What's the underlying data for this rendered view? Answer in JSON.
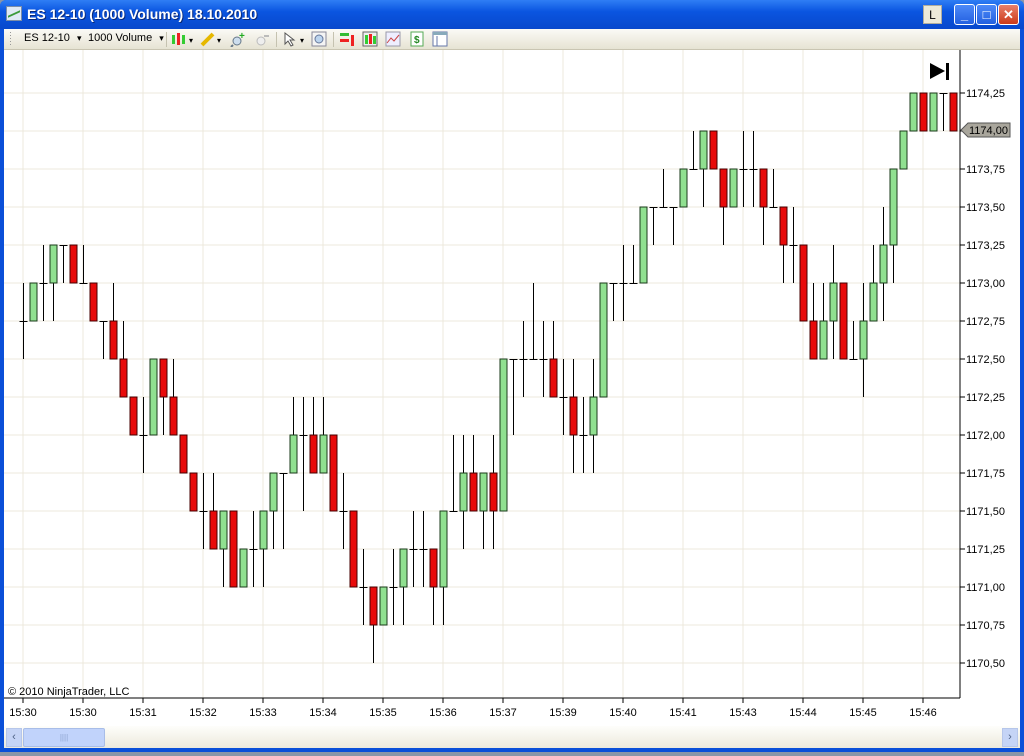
{
  "window": {
    "title": "ES 12-10 (1000 Volume)  18.10.2010",
    "l_button": "L",
    "minimize": "_",
    "maximize": "□",
    "close": "✕"
  },
  "toolbar": {
    "instrument": "ES 12-10",
    "interval": "1000 Volume",
    "dropdown": "▾",
    "icons": [
      "chart-style-icon",
      "drawing-pencil-icon",
      "zoom-in-icon",
      "zoom-out-icon",
      "cursor-icon",
      "data-box-icon",
      "strategies-icon",
      "indicators-icon",
      "chart-properties-icon",
      "dollar-icon",
      "properties-panel-icon"
    ]
  },
  "chart": {
    "copyright": "© 2010 NinjaTrader, LLC",
    "current_price_label": "1174,00",
    "scroll_to_end_icon": "skip-to-end-icon",
    "colors": {
      "up": "#90e090",
      "down": "#e80a0a",
      "grid": "#ece9dc"
    },
    "scrollbar": {
      "grip": "||||",
      "left": "‹",
      "right": "›"
    }
  },
  "chart_data": {
    "type": "candlestick",
    "title": "ES 12-10 (1000 Volume)",
    "ylim": [
      1170.5,
      1174.25
    ],
    "y_ticks": [
      "1174,25",
      "1174,00",
      "1173,75",
      "1173,50",
      "1173,25",
      "1173,00",
      "1172,75",
      "1172,50",
      "1172,25",
      "1172,00",
      "1171,75",
      "1171,50",
      "1171,25",
      "1171,00",
      "1170,75",
      "1170,50"
    ],
    "x_ticks": [
      "15:30",
      "15:30",
      "15:31",
      "15:32",
      "15:33",
      "15:34",
      "15:35",
      "15:36",
      "15:37",
      "15:39",
      "15:40",
      "15:41",
      "15:43",
      "15:44",
      "15:45",
      "15:46"
    ],
    "x_tick_every": 6,
    "ohlc": [
      [
        1172.75,
        1173,
        1172.5,
        1172.75
      ],
      [
        1172.75,
        1173,
        1172.75,
        1173
      ],
      [
        1173,
        1173.25,
        1172.75,
        1173
      ],
      [
        1173,
        1173.25,
        1172.75,
        1173.25
      ],
      [
        1173.25,
        1173.25,
        1173,
        1173.25
      ],
      [
        1173.25,
        1173.25,
        1173,
        1173
      ],
      [
        1173,
        1173.25,
        1173,
        1173
      ],
      [
        1173,
        1173,
        1172.75,
        1172.75
      ],
      [
        1172.75,
        1172.75,
        1172.5,
        1172.75
      ],
      [
        1172.75,
        1173,
        1172.5,
        1172.5
      ],
      [
        1172.5,
        1172.75,
        1172.25,
        1172.25
      ],
      [
        1172.25,
        1172.25,
        1172,
        1172
      ],
      [
        1172,
        1172.25,
        1171.75,
        1172
      ],
      [
        1172,
        1172.5,
        1172,
        1172.5
      ],
      [
        1172.5,
        1172.5,
        1172,
        1172.25
      ],
      [
        1172.25,
        1172.5,
        1172,
        1172
      ],
      [
        1172,
        1172,
        1171.75,
        1171.75
      ],
      [
        1171.75,
        1171.75,
        1171.5,
        1171.5
      ],
      [
        1171.5,
        1171.75,
        1171.25,
        1171.5
      ],
      [
        1171.5,
        1171.75,
        1171.25,
        1171.25
      ],
      [
        1171.25,
        1171.5,
        1171,
        1171.5
      ],
      [
        1171.5,
        1171.5,
        1171,
        1171
      ],
      [
        1171,
        1171.25,
        1171,
        1171.25
      ],
      [
        1171.25,
        1171.5,
        1171,
        1171.25
      ],
      [
        1171.25,
        1171.5,
        1171,
        1171.5
      ],
      [
        1171.5,
        1171.75,
        1171.25,
        1171.75
      ],
      [
        1171.75,
        1171.75,
        1171.25,
        1171.75
      ],
      [
        1171.75,
        1172.25,
        1171.75,
        1172
      ],
      [
        1172,
        1172.25,
        1171.5,
        1172
      ],
      [
        1172,
        1172.25,
        1171.75,
        1171.75
      ],
      [
        1171.75,
        1172.25,
        1171.75,
        1172
      ],
      [
        1172,
        1172,
        1171.5,
        1171.5
      ],
      [
        1171.5,
        1171.75,
        1171.25,
        1171.5
      ],
      [
        1171.5,
        1171.5,
        1171,
        1171
      ],
      [
        1171,
        1171.25,
        1170.75,
        1171
      ],
      [
        1171,
        1171,
        1170.5,
        1170.75
      ],
      [
        1170.75,
        1171,
        1170.75,
        1171
      ],
      [
        1171,
        1171.25,
        1170.75,
        1171
      ],
      [
        1171,
        1171.25,
        1170.75,
        1171.25
      ],
      [
        1171.25,
        1171.5,
        1171,
        1171.25
      ],
      [
        1171.25,
        1171.5,
        1171,
        1171.25
      ],
      [
        1171.25,
        1171.25,
        1170.75,
        1171
      ],
      [
        1171,
        1171.5,
        1170.75,
        1171.5
      ],
      [
        1171.5,
        1172,
        1171.5,
        1171.5
      ],
      [
        1171.5,
        1172,
        1171.25,
        1171.75
      ],
      [
        1171.75,
        1172,
        1171.5,
        1171.5
      ],
      [
        1171.5,
        1171.75,
        1171.25,
        1171.75
      ],
      [
        1171.75,
        1172,
        1171.25,
        1171.5
      ],
      [
        1171.5,
        1172.5,
        1171.5,
        1172.5
      ],
      [
        1172.5,
        1172.5,
        1172,
        1172.5
      ],
      [
        1172.5,
        1172.75,
        1172.25,
        1172.5
      ],
      [
        1172.5,
        1173,
        1172.5,
        1172.5
      ],
      [
        1172.5,
        1172.75,
        1172.25,
        1172.5
      ],
      [
        1172.5,
        1172.75,
        1172.25,
        1172.25
      ],
      [
        1172.25,
        1172.5,
        1172,
        1172.25
      ],
      [
        1172.25,
        1172.5,
        1171.75,
        1172
      ],
      [
        1172,
        1172.25,
        1171.75,
        1172
      ],
      [
        1172,
        1172.5,
        1171.75,
        1172.25
      ],
      [
        1172.25,
        1173,
        1172.25,
        1173
      ],
      [
        1173,
        1173,
        1172.75,
        1173
      ],
      [
        1173,
        1173.25,
        1172.75,
        1173
      ],
      [
        1173,
        1173.25,
        1173,
        1173
      ],
      [
        1173,
        1173.5,
        1173,
        1173.5
      ],
      [
        1173.5,
        1173.5,
        1173.25,
        1173.5
      ],
      [
        1173.5,
        1173.75,
        1173.5,
        1173.5
      ],
      [
        1173.5,
        1173.5,
        1173.25,
        1173.5
      ],
      [
        1173.5,
        1173.75,
        1173.5,
        1173.75
      ],
      [
        1173.75,
        1174,
        1173.75,
        1173.75
      ],
      [
        1173.75,
        1174,
        1173.5,
        1174
      ],
      [
        1174,
        1174,
        1173.75,
        1173.75
      ],
      [
        1173.75,
        1173.75,
        1173.25,
        1173.5
      ],
      [
        1173.5,
        1173.75,
        1173.5,
        1173.75
      ],
      [
        1173.75,
        1174,
        1173.5,
        1173.75
      ],
      [
        1173.75,
        1174,
        1173.5,
        1173.75
      ],
      [
        1173.75,
        1173.75,
        1173.25,
        1173.5
      ],
      [
        1173.5,
        1173.75,
        1173.5,
        1173.5
      ],
      [
        1173.5,
        1173.5,
        1173,
        1173.25
      ],
      [
        1173.25,
        1173.5,
        1173,
        1173.25
      ],
      [
        1173.25,
        1173.25,
        1172.75,
        1172.75
      ],
      [
        1172.75,
        1173,
        1172.5,
        1172.5
      ],
      [
        1172.5,
        1173,
        1172.5,
        1172.75
      ],
      [
        1172.75,
        1173.25,
        1172.5,
        1173
      ],
      [
        1173,
        1173,
        1172.5,
        1172.5
      ],
      [
        1172.5,
        1172.75,
        1172.5,
        1172.5
      ],
      [
        1172.5,
        1173,
        1172.25,
        1172.75
      ],
      [
        1172.75,
        1173.25,
        1172.75,
        1173
      ],
      [
        1173,
        1173.5,
        1172.75,
        1173.25
      ],
      [
        1173.25,
        1173.75,
        1173,
        1173.75
      ],
      [
        1173.75,
        1174,
        1173.75,
        1174
      ],
      [
        1174,
        1174.25,
        1174,
        1174.25
      ],
      [
        1174.25,
        1174.25,
        1174,
        1174
      ],
      [
        1174,
        1174.25,
        1174,
        1174.25
      ],
      [
        1174.25,
        1174.25,
        1174,
        1174.25
      ],
      [
        1174.25,
        1174.25,
        1174,
        1174
      ]
    ],
    "last_price": 1174.0,
    "grid": true
  }
}
